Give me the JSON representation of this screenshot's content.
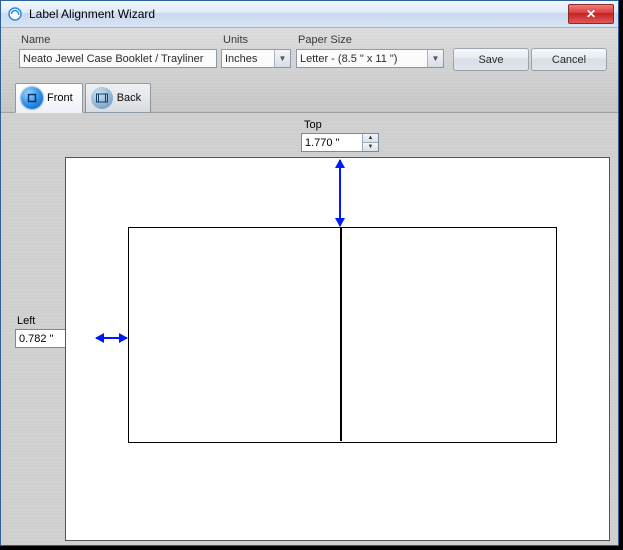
{
  "window": {
    "title": "Label Alignment Wizard"
  },
  "fields": {
    "name": {
      "label": "Name",
      "value": "Neato Jewel Case Booklet / Trayliner"
    },
    "units": {
      "label": "Units",
      "value": "Inches"
    },
    "paper": {
      "label": "Paper Size",
      "value": "Letter - (8.5 \" x 11 \")"
    }
  },
  "buttons": {
    "save": "Save",
    "cancel": "Cancel"
  },
  "tabs": {
    "front": "Front",
    "back": "Back"
  },
  "margins": {
    "top": {
      "label": "Top",
      "value": "1.770 \""
    },
    "left": {
      "label": "Left",
      "value": "0.782 \""
    }
  }
}
